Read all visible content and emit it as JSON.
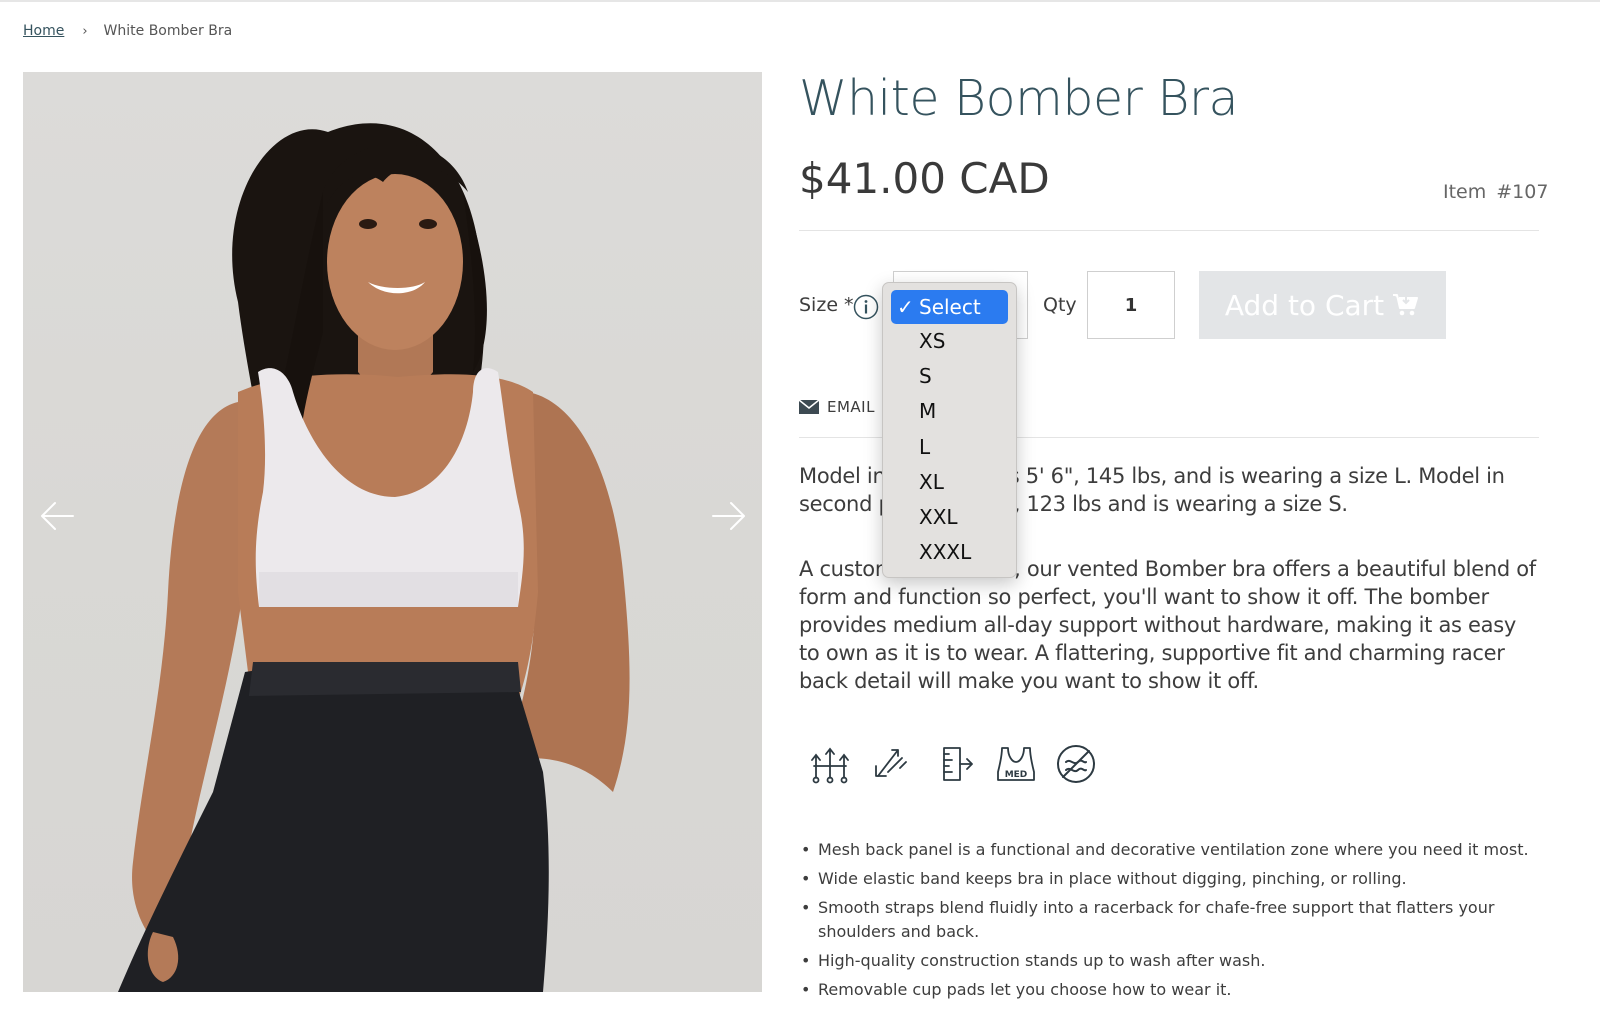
{
  "breadcrumb": {
    "home": "Home",
    "separator": "›",
    "current": "White Bomber Bra"
  },
  "product": {
    "title": "White Bomber Bra",
    "price": "$41.00 CAD",
    "item_label": "Item",
    "item_number": "#107"
  },
  "options": {
    "size_label": "Size *",
    "size_selected": "Select",
    "size_options": [
      "Select",
      "XS",
      "S",
      "M",
      "L",
      "XL",
      "XXL",
      "XXXL"
    ],
    "qty_label": "Qty",
    "qty_value": "1",
    "add_to_cart": "Add to Cart"
  },
  "share": {
    "email_label": "EMAIL"
  },
  "description": {
    "p1": "Model in first photo is 5' 6\", 145 lbs, and is wearing a size L. Model in second photo is 5' 7\", 123 lbs and is wearing a size S.",
    "p2": "A customer favourite, our vented Bomber bra offers a beautiful blend of form and function so perfect, you'll want to show it off. The bomber provides medium all-day support without hardware, making it as easy to own as it is to wear. A flattering, supportive fit and charming racer back detail will make you want to show it off."
  },
  "features": {
    "icons": [
      "ventilation-icon",
      "moisture-wicking-icon",
      "size-guide-icon",
      "medium-support-icon",
      "no-chafe-icon"
    ],
    "med_badge": "MED"
  },
  "bullets": [
    "Mesh back panel is a functional and decorative ventilation zone where you need it most.",
    "Wide elastic band keeps bra in place without digging, pinching, or rolling.",
    "Smooth straps blend fluidly into a racerback for chafe-free support that flatters your shoulders and back.",
    "High-quality construction stands up to wash after wash.",
    "Removable cup pads let you choose how to wear it."
  ],
  "colors": {
    "title": "#35535e",
    "dropdown_highlight": "#2b7bf0",
    "cart_button_disabled": "#e3e5e7"
  }
}
